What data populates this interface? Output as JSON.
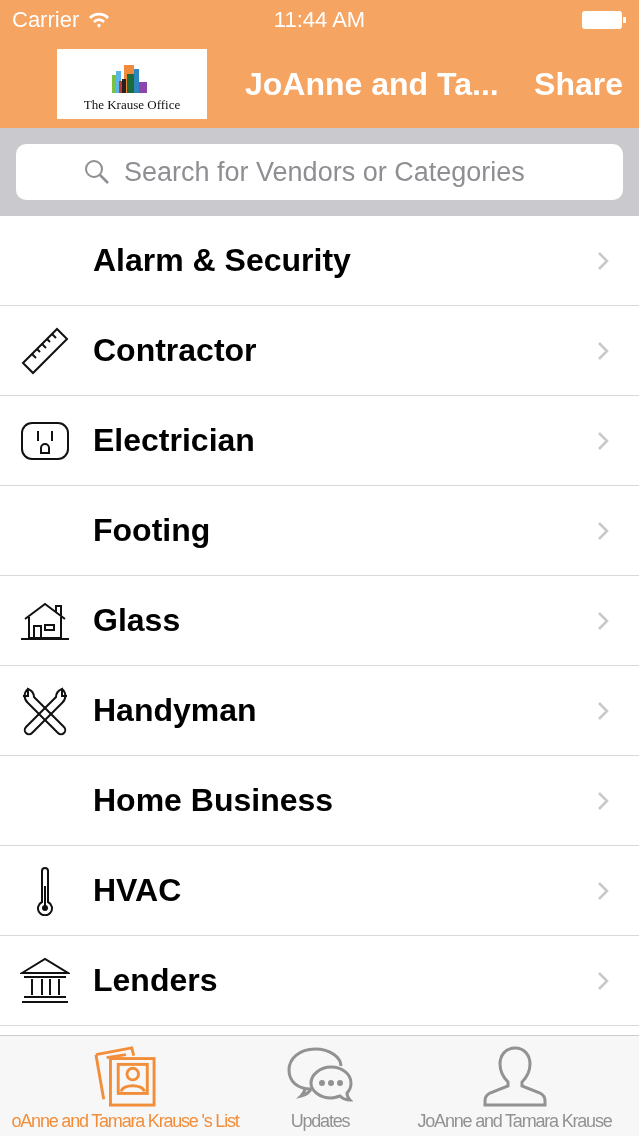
{
  "status_bar": {
    "carrier": "Carrier",
    "time": "11:44 AM"
  },
  "nav_bar": {
    "logo_text": "The Krause Office",
    "title": "JoAnne and Ta...",
    "action": "Share"
  },
  "search": {
    "placeholder": "Search for Vendors or Categories"
  },
  "categories": [
    {
      "label": "Alarm & Security",
      "kind": "none"
    },
    {
      "label": "Contractor",
      "kind": "ruler"
    },
    {
      "label": "Electrician",
      "kind": "outlet"
    },
    {
      "label": "Footing",
      "kind": "none"
    },
    {
      "label": "Glass",
      "kind": "house"
    },
    {
      "label": "Handyman",
      "kind": "wrenches"
    },
    {
      "label": "Home Business",
      "kind": "none"
    },
    {
      "label": "HVAC",
      "kind": "thermometer"
    },
    {
      "label": "Lenders",
      "kind": "bank"
    }
  ],
  "tab_bar": [
    {
      "label": "oAnne and Tamara Krause 's List",
      "kind": "photos",
      "selected": true
    },
    {
      "label": "Updates",
      "kind": "chat",
      "selected": false
    },
    {
      "label": "JoAnne and Tamara Krause",
      "kind": "person",
      "selected": false
    }
  ]
}
